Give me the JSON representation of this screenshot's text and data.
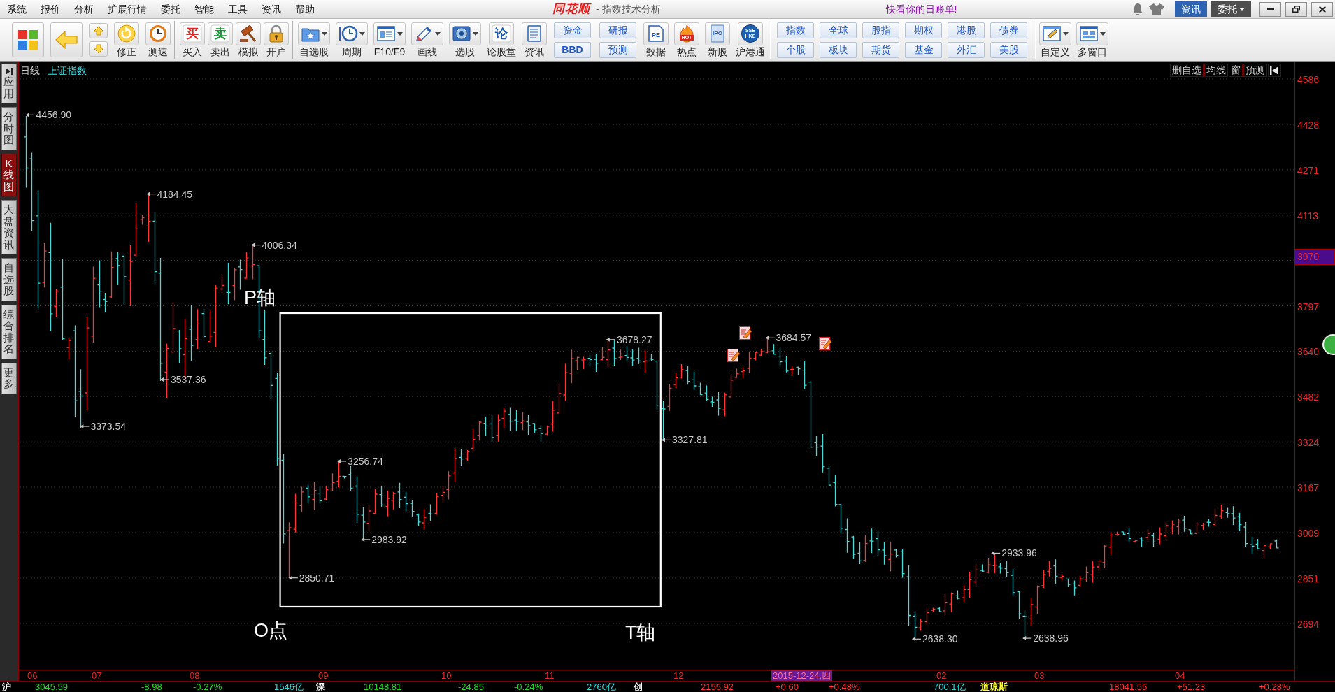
{
  "menu_bar": {
    "items": [
      "系统",
      "报价",
      "分析",
      "扩展行情",
      "委托",
      "智能",
      "工具",
      "资讯",
      "帮助"
    ],
    "logo": "同花顺",
    "title": "- 指数技术分析",
    "promo": "快看你的日账单!",
    "buttons": [
      {
        "label": "资讯",
        "selected": true,
        "dropdown": false
      },
      {
        "label": "委托",
        "selected": false,
        "dropdown": true
      }
    ]
  },
  "toolbar": {
    "groups": [
      [
        {
          "kind": "big"
        },
        {
          "kind": "big"
        },
        {
          "kind": "arrows"
        },
        {
          "kind": "tool",
          "label": "修正",
          "dropdown": false
        },
        {
          "kind": "tool",
          "label": "测速",
          "dropdown": false
        }
      ],
      [
        {
          "kind": "tool",
          "label": "买入",
          "glyph": "买",
          "color": "#e8231f",
          "dropdown": false
        },
        {
          "kind": "tool",
          "label": "卖出",
          "glyph": "卖",
          "color": "#119a35",
          "dropdown": false
        },
        {
          "kind": "tool",
          "label": "模拟",
          "dropdown": false
        },
        {
          "kind": "tool",
          "label": "开户",
          "dropdown": false
        }
      ],
      [
        {
          "kind": "tool",
          "label": "自选股",
          "dropdown": true
        },
        {
          "kind": "tool",
          "label": "周期",
          "dropdown": true
        },
        {
          "kind": "tool",
          "label": "F10/F9",
          "dropdown": true
        },
        {
          "kind": "tool",
          "label": "画线",
          "dropdown": true
        },
        {
          "kind": "tool",
          "label": "选股",
          "dropdown": true
        },
        {
          "kind": "tool",
          "label": "论股堂",
          "glyph": "论",
          "color": "#1e5bb8",
          "dropdown": false
        },
        {
          "kind": "tool",
          "label": "资讯",
          "dropdown": false
        },
        {
          "kind": "pair",
          "labels": [
            {
              "text": "资金",
              "bold": false
            },
            {
              "text": "BBD",
              "bold": true
            }
          ]
        },
        {
          "kind": "pair",
          "labels": [
            {
              "text": "研报",
              "bold": false
            },
            {
              "text": "预测",
              "bold": false
            }
          ]
        },
        {
          "kind": "tool",
          "label": "数据",
          "glyph": "PE",
          "dropdown": false
        },
        {
          "kind": "tool",
          "label": "热点",
          "glyph": "HOT",
          "dropdown": false
        },
        {
          "kind": "tool",
          "label": "新股",
          "glyph": "IPO",
          "dropdown": false
        },
        {
          "kind": "tool",
          "label": "沪港通",
          "glyph": "SSE HKE",
          "dropdown": false
        }
      ],
      [
        {
          "kind": "grid",
          "labels": [
            "指数",
            "全球",
            "股指",
            "期权",
            "港股",
            "债券",
            "个股",
            "板块",
            "期货",
            "基金",
            "外汇",
            "美股"
          ]
        }
      ],
      [
        {
          "kind": "tool",
          "label": "自定义",
          "dropdown": true
        },
        {
          "kind": "tool",
          "label": "多窗口",
          "dropdown": true
        }
      ]
    ]
  },
  "side_tabs": [
    {
      "label": "应用",
      "selected": false
    },
    {
      "label": "分时图",
      "selected": false
    },
    {
      "label": "K线图",
      "selected": true
    },
    {
      "label": "大盘资讯",
      "selected": false
    },
    {
      "label": "自选股",
      "selected": false
    },
    {
      "label": "综合排名",
      "selected": false
    },
    {
      "label": "更多.",
      "selected": false
    }
  ],
  "chart": {
    "period": "日线",
    "name": "上证指数",
    "tools": [
      "删自选",
      "均线",
      "窗",
      "预测"
    ],
    "price_axis": [
      {
        "text": "4586",
        "highlighted": false
      },
      {
        "text": "4428",
        "highlighted": false
      },
      {
        "text": "4271",
        "highlighted": false
      },
      {
        "text": "4113",
        "highlighted": false
      },
      {
        "text": "3970",
        "highlighted": true
      },
      {
        "text": "3797",
        "highlighted": false
      },
      {
        "text": "3640",
        "highlighted": false
      },
      {
        "text": "3482",
        "highlighted": false
      },
      {
        "text": "3324",
        "highlighted": false
      },
      {
        "text": "3167",
        "highlighted": false
      },
      {
        "text": "3009",
        "highlighted": false
      },
      {
        "text": "2851",
        "highlighted": false
      },
      {
        "text": "2694",
        "highlighted": false
      }
    ],
    "time_axis": [
      {
        "text": "06",
        "highlighted": false
      },
      {
        "text": "07",
        "highlighted": false
      },
      {
        "text": "08",
        "highlighted": false
      },
      {
        "text": "09",
        "highlighted": false
      },
      {
        "text": "10",
        "highlighted": false
      },
      {
        "text": "11",
        "highlighted": false
      },
      {
        "text": "12",
        "highlighted": false
      },
      {
        "text": "2015-12-24,四",
        "highlighted": true
      },
      {
        "text": "02",
        "highlighted": false
      },
      {
        "text": "03",
        "highlighted": false
      },
      {
        "text": "04",
        "highlighted": false
      }
    ],
    "price_labels": [
      "4456.90",
      "4184.45",
      "4006.34",
      "3684.57",
      "3678.27",
      "3537.36",
      "3373.54",
      "3327.81",
      "3256.74",
      "2983.92",
      "2933.96",
      "2850.71",
      "2638.96",
      "2638.30"
    ],
    "annotations": [
      "P轴",
      "O点",
      "T轴"
    ]
  },
  "status_bar": [
    {
      "text": "沪",
      "kind": "market",
      "color": "#ffffff"
    },
    {
      "text": "3045.59",
      "kind": "price",
      "color": "#22dd22"
    },
    {
      "text": "-8.98",
      "kind": "change",
      "color": "#22dd22"
    },
    {
      "text": "-0.27%",
      "kind": "percent",
      "color": "#22dd22"
    },
    {
      "text": "1546亿",
      "kind": "volume",
      "color": "#33dddd"
    },
    {
      "text": "深",
      "kind": "market",
      "color": "#ffffff"
    },
    {
      "text": "10148.81",
      "kind": "price",
      "color": "#22dd22"
    },
    {
      "text": "-24.85",
      "kind": "change",
      "color": "#22dd22"
    },
    {
      "text": "-0.24%",
      "kind": "percent",
      "color": "#22dd22"
    },
    {
      "text": "2760亿",
      "kind": "volume",
      "color": "#33dddd"
    },
    {
      "text": "创",
      "kind": "market",
      "color": "#ffffff"
    },
    {
      "text": "2155.92",
      "kind": "price",
      "color": "#ff3333"
    },
    {
      "text": "+0.60",
      "kind": "change",
      "color": "#ff3333"
    },
    {
      "text": "+0.48%",
      "kind": "percent",
      "color": "#ff3333"
    },
    {
      "text": "700.1亿",
      "kind": "volume",
      "color": "#33dddd"
    },
    {
      "text": "道琼斯",
      "kind": "market",
      "color": "#ffff33"
    },
    {
      "text": "18041.55",
      "kind": "price",
      "color": "#ff3333"
    },
    {
      "text": "+51.23",
      "kind": "change",
      "color": "#ff3333"
    },
    {
      "text": "+0.28%",
      "kind": "percent",
      "color": "#ff3333"
    }
  ]
}
